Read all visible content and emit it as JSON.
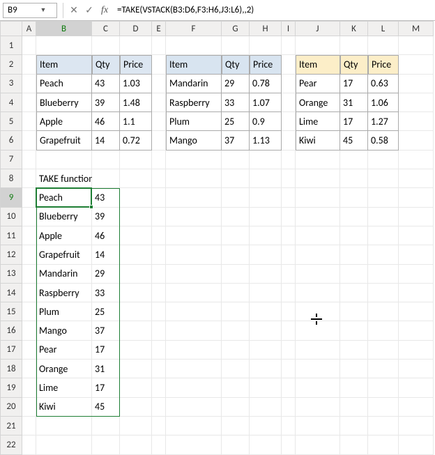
{
  "cell_ref": "B9",
  "formula": "=TAKE(VSTACK(B3:D6,F3:H6,J3:L6),,2)",
  "columns": [
    "A",
    "B",
    "C",
    "D",
    "E",
    "F",
    "G",
    "H",
    "I",
    "J",
    "K",
    "L",
    "M"
  ],
  "row_count": 22,
  "tables": {
    "t1": {
      "headers": [
        "Item",
        "Qty",
        "Price"
      ],
      "rows": [
        [
          "Peach",
          "43",
          "1.03"
        ],
        [
          "Blueberry",
          "39",
          "1.48"
        ],
        [
          "Apple",
          "46",
          "1.1"
        ],
        [
          "Grapefruit",
          "14",
          "0.72"
        ]
      ]
    },
    "t2": {
      "headers": [
        "Item",
        "Qty",
        "Price"
      ],
      "rows": [
        [
          "Mandarin",
          "29",
          "0.78"
        ],
        [
          "Raspberry",
          "33",
          "1.07"
        ],
        [
          "Plum",
          "25",
          "0.9"
        ],
        [
          "Mango",
          "37",
          "1.13"
        ]
      ]
    },
    "t3": {
      "headers": [
        "Item",
        "Qty",
        "Price"
      ],
      "rows": [
        [
          "Pear",
          "17",
          "0.63"
        ],
        [
          "Orange",
          "31",
          "1.06"
        ],
        [
          "Lime",
          "17",
          "1.27"
        ],
        [
          "Kiwi",
          "45",
          "0.58"
        ]
      ]
    }
  },
  "caption": "TAKE function - multiple sources",
  "result": [
    [
      "Peach",
      "43"
    ],
    [
      "Blueberry",
      "39"
    ],
    [
      "Apple",
      "46"
    ],
    [
      "Grapefruit",
      "14"
    ],
    [
      "Mandarin",
      "29"
    ],
    [
      "Raspberry",
      "33"
    ],
    [
      "Plum",
      "25"
    ],
    [
      "Mango",
      "37"
    ],
    [
      "Pear",
      "17"
    ],
    [
      "Orange",
      "31"
    ],
    [
      "Lime",
      "17"
    ],
    [
      "Kiwi",
      "45"
    ]
  ]
}
